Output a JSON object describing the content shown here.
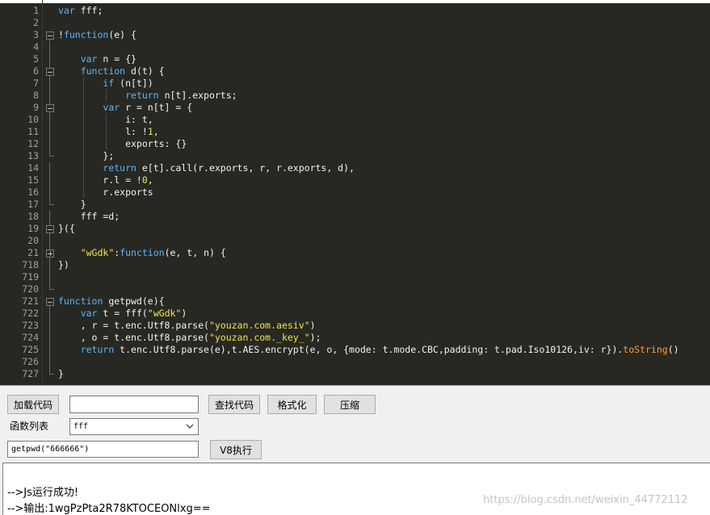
{
  "editor": {
    "lines": [
      {
        "num": "1",
        "fold": "",
        "segs": [
          {
            "c": "k",
            "t": "var"
          },
          {
            "c": "d",
            "t": " fff;"
          }
        ]
      },
      {
        "num": "2",
        "fold": "",
        "segs": []
      },
      {
        "num": "3",
        "fold": "minus",
        "segs": [
          {
            "c": "d",
            "t": "!"
          },
          {
            "c": "k",
            "t": "function"
          },
          {
            "c": "d",
            "t": "(e) {"
          }
        ]
      },
      {
        "num": "4",
        "fold": "line",
        "segs": []
      },
      {
        "num": "5",
        "fold": "line",
        "segs": [
          {
            "c": "d",
            "t": "    "
          },
          {
            "c": "k",
            "t": "var"
          },
          {
            "c": "d",
            "t": " n = {}"
          }
        ]
      },
      {
        "num": "6",
        "fold": "minus",
        "segs": [
          {
            "c": "d",
            "t": "    "
          },
          {
            "c": "k",
            "t": "function"
          },
          {
            "c": "d",
            "t": " d(t) {"
          }
        ]
      },
      {
        "num": "7",
        "fold": "line",
        "segs": [
          {
            "c": "d",
            "t": "        "
          },
          {
            "c": "k",
            "t": "if"
          },
          {
            "c": "d",
            "t": " (n[t])"
          }
        ]
      },
      {
        "num": "8",
        "fold": "line",
        "segs": [
          {
            "c": "d",
            "t": "            "
          },
          {
            "c": "k",
            "t": "return"
          },
          {
            "c": "d",
            "t": " n[t].exports;"
          }
        ]
      },
      {
        "num": "9",
        "fold": "minus",
        "segs": [
          {
            "c": "d",
            "t": "        "
          },
          {
            "c": "k",
            "t": "var"
          },
          {
            "c": "d",
            "t": " r = n[t] = {"
          }
        ]
      },
      {
        "num": "10",
        "fold": "line",
        "segs": [
          {
            "c": "d",
            "t": "            i: t,"
          }
        ]
      },
      {
        "num": "11",
        "fold": "line",
        "segs": [
          {
            "c": "d",
            "t": "            l: !"
          },
          {
            "c": "n",
            "t": "1"
          },
          {
            "c": "d",
            "t": ","
          }
        ]
      },
      {
        "num": "12",
        "fold": "line",
        "segs": [
          {
            "c": "d",
            "t": "            exports: {}"
          }
        ]
      },
      {
        "num": "13",
        "fold": "end",
        "segs": [
          {
            "c": "d",
            "t": "        };"
          }
        ]
      },
      {
        "num": "14",
        "fold": "line",
        "segs": [
          {
            "c": "d",
            "t": "        "
          },
          {
            "c": "k",
            "t": "return"
          },
          {
            "c": "d",
            "t": " e[t].call(r.exports, r, r.exports, d),"
          }
        ]
      },
      {
        "num": "15",
        "fold": "line",
        "segs": [
          {
            "c": "d",
            "t": "        r.l = !"
          },
          {
            "c": "n",
            "t": "0"
          },
          {
            "c": "d",
            "t": ","
          }
        ]
      },
      {
        "num": "16",
        "fold": "line",
        "segs": [
          {
            "c": "d",
            "t": "        r.exports"
          }
        ]
      },
      {
        "num": "17",
        "fold": "end",
        "segs": [
          {
            "c": "d",
            "t": "    }"
          }
        ]
      },
      {
        "num": "18",
        "fold": "line",
        "segs": [
          {
            "c": "d",
            "t": "    fff =d;"
          }
        ]
      },
      {
        "num": "19",
        "fold": "minus",
        "segs": [
          {
            "c": "d",
            "t": "}({"
          }
        ]
      },
      {
        "num": "20",
        "fold": "line",
        "segs": []
      },
      {
        "num": "21",
        "fold": "plus",
        "segs": [
          {
            "c": "d",
            "t": "    "
          },
          {
            "c": "s",
            "t": "\"wGdk\""
          },
          {
            "c": "d",
            "t": ":"
          },
          {
            "c": "k",
            "t": "function"
          },
          {
            "c": "d",
            "t": "(e, t, n) {"
          }
        ]
      },
      {
        "num": "718",
        "fold": "line",
        "segs": [
          {
            "c": "d",
            "t": "})"
          }
        ]
      },
      {
        "num": "719",
        "fold": "line",
        "segs": []
      },
      {
        "num": "720",
        "fold": "end",
        "segs": []
      },
      {
        "num": "721",
        "fold": "minus",
        "segs": [
          {
            "c": "k",
            "t": "function"
          },
          {
            "c": "d",
            "t": " getpwd(e){"
          }
        ]
      },
      {
        "num": "722",
        "fold": "line",
        "segs": [
          {
            "c": "d",
            "t": "    "
          },
          {
            "c": "k",
            "t": "var"
          },
          {
            "c": "d",
            "t": " t = fff("
          },
          {
            "c": "s",
            "t": "\"wGdk\""
          },
          {
            "c": "d",
            "t": ")"
          }
        ]
      },
      {
        "num": "723",
        "fold": "line",
        "segs": [
          {
            "c": "d",
            "t": "    , r = t.enc.Utf8.parse("
          },
          {
            "c": "s",
            "t": "\"youzan.com.aesiv\""
          },
          {
            "c": "d",
            "t": ")"
          }
        ]
      },
      {
        "num": "724",
        "fold": "line",
        "segs": [
          {
            "c": "d",
            "t": "    , o = t.enc.Utf8.parse("
          },
          {
            "c": "s",
            "t": "\"youzan.com._key_\""
          },
          {
            "c": "d",
            "t": ");"
          }
        ]
      },
      {
        "num": "725",
        "fold": "line",
        "segs": [
          {
            "c": "d",
            "t": "    "
          },
          {
            "c": "k",
            "t": "return"
          },
          {
            "c": "d",
            "t": " t.enc.Utf8.parse(e),t.AES.encrypt(e, o, {mode: t.mode.CBC,padding: t.pad.Iso10126,iv: r})."
          },
          {
            "c": "f",
            "t": "toString"
          },
          {
            "c": "d",
            "t": "()"
          }
        ]
      },
      {
        "num": "726",
        "fold": "line",
        "segs": []
      },
      {
        "num": "727",
        "fold": "end",
        "segs": [
          {
            "c": "d",
            "t": "}"
          }
        ]
      }
    ]
  },
  "toolbar": {
    "load_label": "加载代码",
    "search_value": "",
    "find_label": "查找代码",
    "format_label": "格式化",
    "compress_label": "压缩"
  },
  "functions": {
    "label": "函数列表",
    "selected": "fff"
  },
  "call": {
    "input_value": "getpwd(\"666666\")",
    "run_label": "V8执行"
  },
  "output": {
    "line1": "-->Js运行成功!",
    "line2": "-->输出:1wgPzPta2R78KTOCEONlxg=="
  },
  "watermark": "https://blog.csdn.net/weixin_44772112"
}
